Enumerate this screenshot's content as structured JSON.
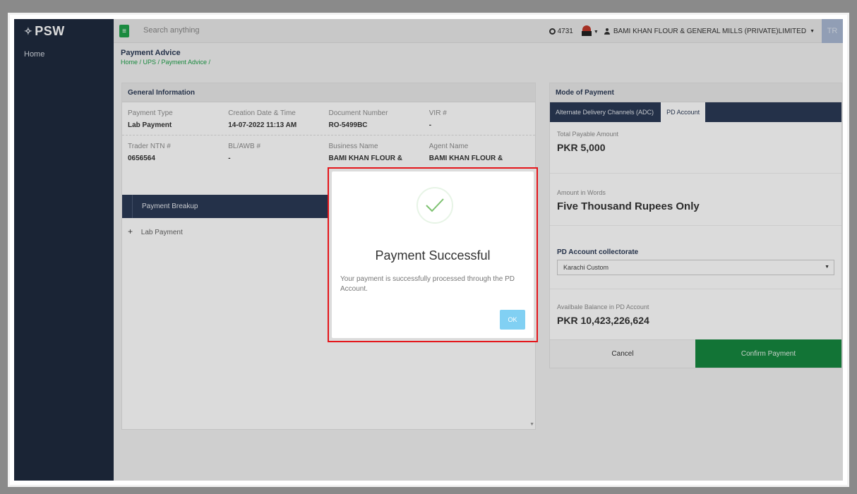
{
  "app": {
    "logo_text": "PSW",
    "logo_symbol": "✧"
  },
  "sidebar": {
    "items": [
      {
        "label": "Home"
      }
    ]
  },
  "topbar": {
    "menu_icon": "hamburger-icon",
    "search_placeholder": "Search anything",
    "credit_count": "4731",
    "user_name": "BAMI KHAN FLOUR & GENERAL MILLS (PRIVATE)LIMITED",
    "user_initials": "TR"
  },
  "page": {
    "title": "Payment Advice",
    "breadcrumb": "Home / UPS / Payment Advice /"
  },
  "general_info": {
    "heading": "General Information",
    "rows": [
      [
        {
          "label": "Payment Type",
          "value": "Lab Payment"
        },
        {
          "label": "Creation Date & Time",
          "value": "14-07-2022 11:13 AM"
        },
        {
          "label": "Document Number",
          "value": "RO-5499BC"
        },
        {
          "label": "VIR #",
          "value": "-"
        }
      ],
      [
        {
          "label": "Trader NTN #",
          "value": "0656564"
        },
        {
          "label": "BL/AWB #",
          "value": "-"
        },
        {
          "label": "Business Name",
          "value": "BAMI KHAN FLOUR &"
        },
        {
          "label": "Agent Name",
          "value": "BAMI KHAN FLOUR &"
        }
      ]
    ],
    "breakup_title": "Payment Breakup",
    "breakup_items": [
      {
        "label": "Lab Payment"
      }
    ]
  },
  "mode_of_payment": {
    "heading": "Mode of Payment",
    "tabs": [
      {
        "label": "Alternate Delivery Channels (ADC)",
        "active": false
      },
      {
        "label": "PD Account",
        "active": true
      }
    ],
    "total_payable_label": "Total Payable Amount",
    "total_payable_value": "PKR 5,000",
    "amount_words_label": "Amount in Words",
    "amount_words_value": "Five Thousand Rupees Only",
    "collectorate_label": "PD Account collectorate",
    "collectorate_value": "Karachi Custom",
    "balance_label": "Availbale Balance in PD Account",
    "balance_value": "PKR 10,423,226,624",
    "cancel_label": "Cancel",
    "confirm_label": "Confirm Payment"
  },
  "modal": {
    "title": "Payment Successful",
    "message": "Your payment is successfully processed through the PD Account.",
    "ok_label": "OK"
  },
  "colors": {
    "sidebar": "#1f2a3e",
    "accent_green": "#16883f",
    "header_navy": "#2b3a55",
    "highlight_red": "#e4161b",
    "ok_blue": "#81d0f3"
  }
}
